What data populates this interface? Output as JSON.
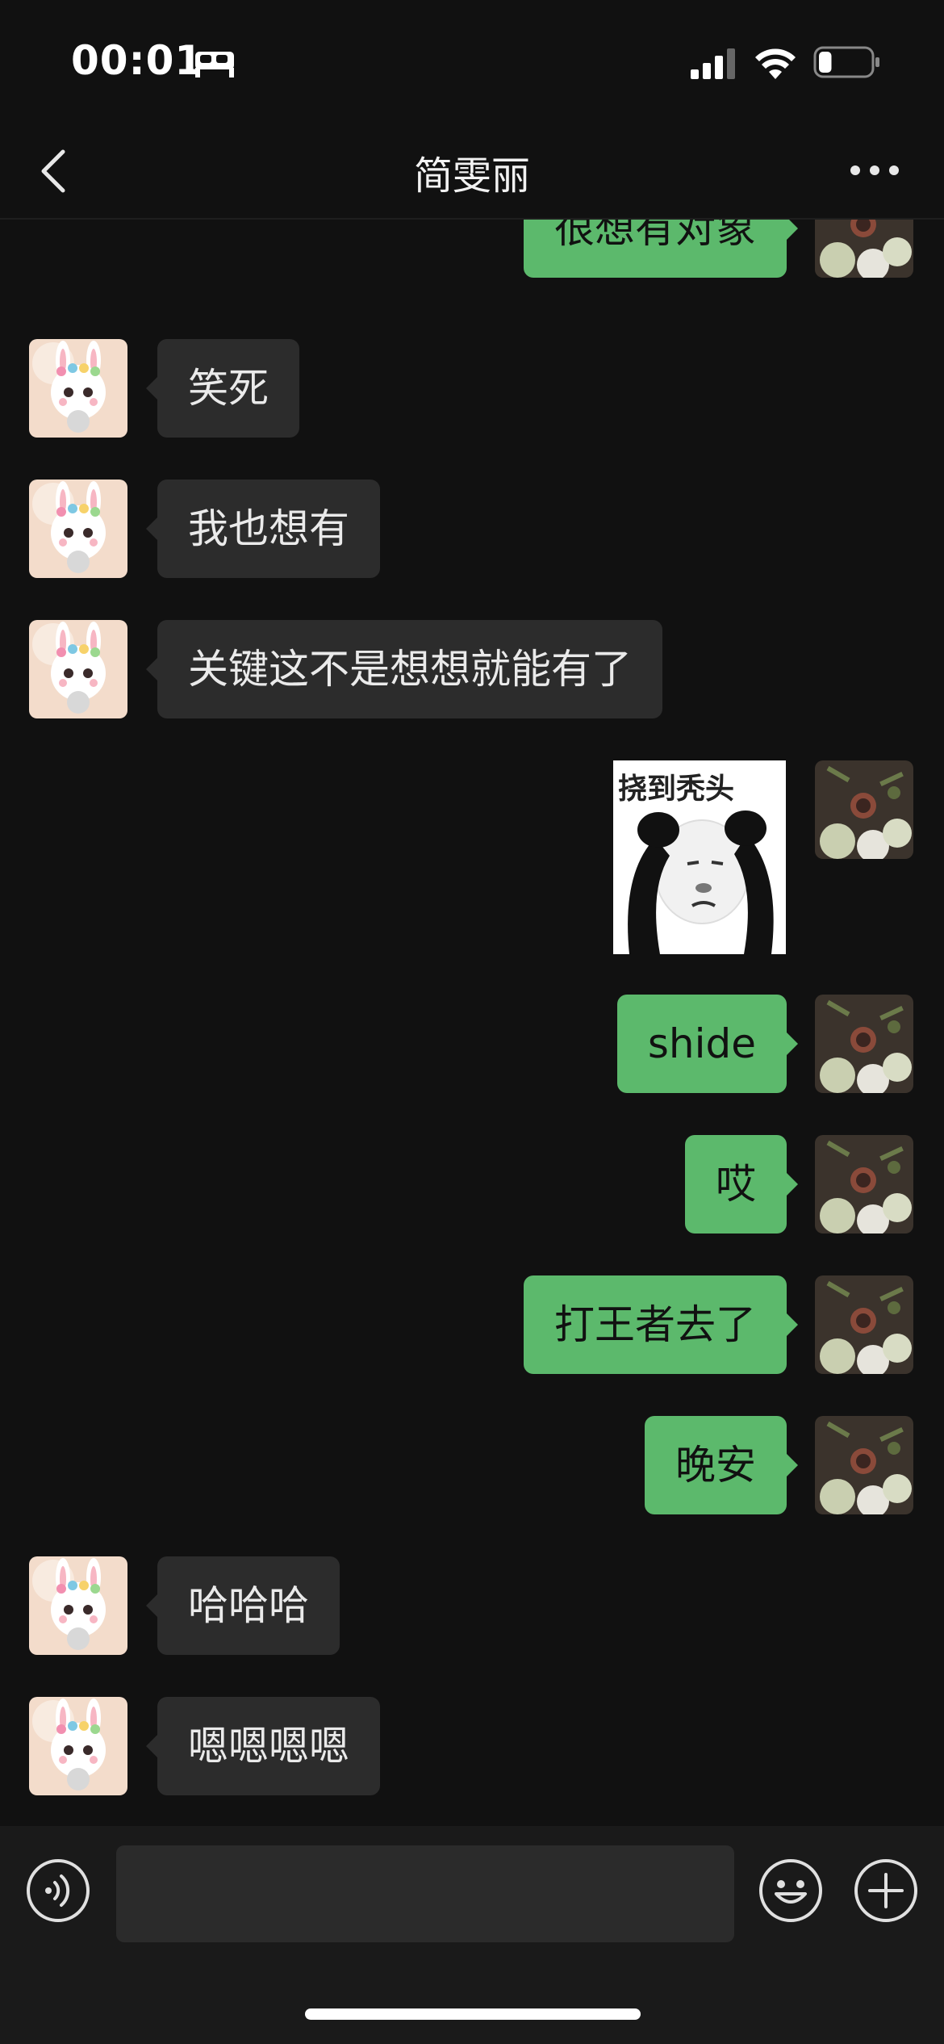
{
  "status_bar": {
    "time": "00:01",
    "sleep_icon": "bed-icon",
    "signal_icon": "cellular-signal-icon",
    "wifi_icon": "wifi-icon",
    "battery_icon": "battery-icon",
    "battery_level": 0.25
  },
  "nav": {
    "title": "简雯丽",
    "back_icon": "chevron-left-icon",
    "more_icon": "more-dots-icon"
  },
  "messages": [
    {
      "side": "right",
      "type": "text",
      "text": "很想有对象"
    },
    {
      "side": "left",
      "type": "text",
      "text": "笑死"
    },
    {
      "side": "left",
      "type": "text",
      "text": "我也想有"
    },
    {
      "side": "left",
      "type": "text",
      "text": "关键这不是想想就能有了"
    },
    {
      "side": "right",
      "type": "sticker",
      "text": "挠到秃头"
    },
    {
      "side": "right",
      "type": "text",
      "text": "shide"
    },
    {
      "side": "right",
      "type": "text",
      "text": "哎"
    },
    {
      "side": "right",
      "type": "text",
      "text": "打王者去了"
    },
    {
      "side": "right",
      "type": "text",
      "text": "晚安"
    },
    {
      "side": "left",
      "type": "text",
      "text": "哈哈哈"
    },
    {
      "side": "left",
      "type": "text",
      "text": "嗯嗯嗯嗯"
    }
  ],
  "input_bar": {
    "voice_icon": "voice-input-icon",
    "text_value": "",
    "emoji_icon": "emoji-icon",
    "plus_icon": "plus-circle-icon"
  },
  "colors": {
    "background": "#111111",
    "outgoing_bubble": "#5cb96c",
    "incoming_bubble": "#2c2c2c"
  }
}
